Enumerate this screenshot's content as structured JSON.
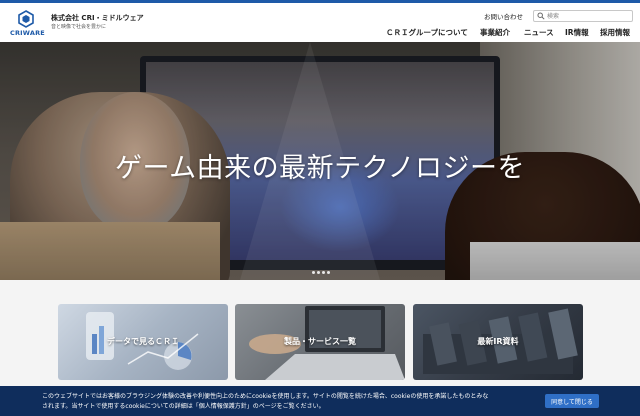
{
  "colors": {
    "brand": "#1e5aa8",
    "cookie_bg": "#0f2d5c",
    "cookie_button": "#2f6fc7"
  },
  "header": {
    "logo_text": "CRIWARE",
    "company_name": "株式会社 CRI・ミドルウェア",
    "company_tagline": "音と映像で社会を豊かに",
    "contact_label": "お問い合わせ",
    "search": {
      "placeholder": "検索",
      "value": "",
      "icon": "search-icon"
    }
  },
  "nav": {
    "items": [
      {
        "label": "ＣＲＩグループについて"
      },
      {
        "label": "事業紹介"
      },
      {
        "label": "ニュース"
      },
      {
        "label": "IR情報"
      },
      {
        "label": "採用情報"
      }
    ]
  },
  "hero": {
    "title": "ゲーム由来の最新テクノロジーを",
    "slide_count": 4,
    "active_slide": 1
  },
  "cards": [
    {
      "label": "データで見るＣＲＩ"
    },
    {
      "label": "製品・サービス一覧"
    },
    {
      "label": "最新IR資料"
    }
  ],
  "cookie": {
    "text": "このウェブサイトではお客様のブラウジング体験の改善や利便性向上のためにcookieを使用します。サイトの閲覧を続けた場合、cookieの使用を承諾したものとみなされます。当サイトで使用するcookieについての詳細は「個人情報保護方針」のページをご覧ください。",
    "accept_label": "同意して閉じる"
  }
}
